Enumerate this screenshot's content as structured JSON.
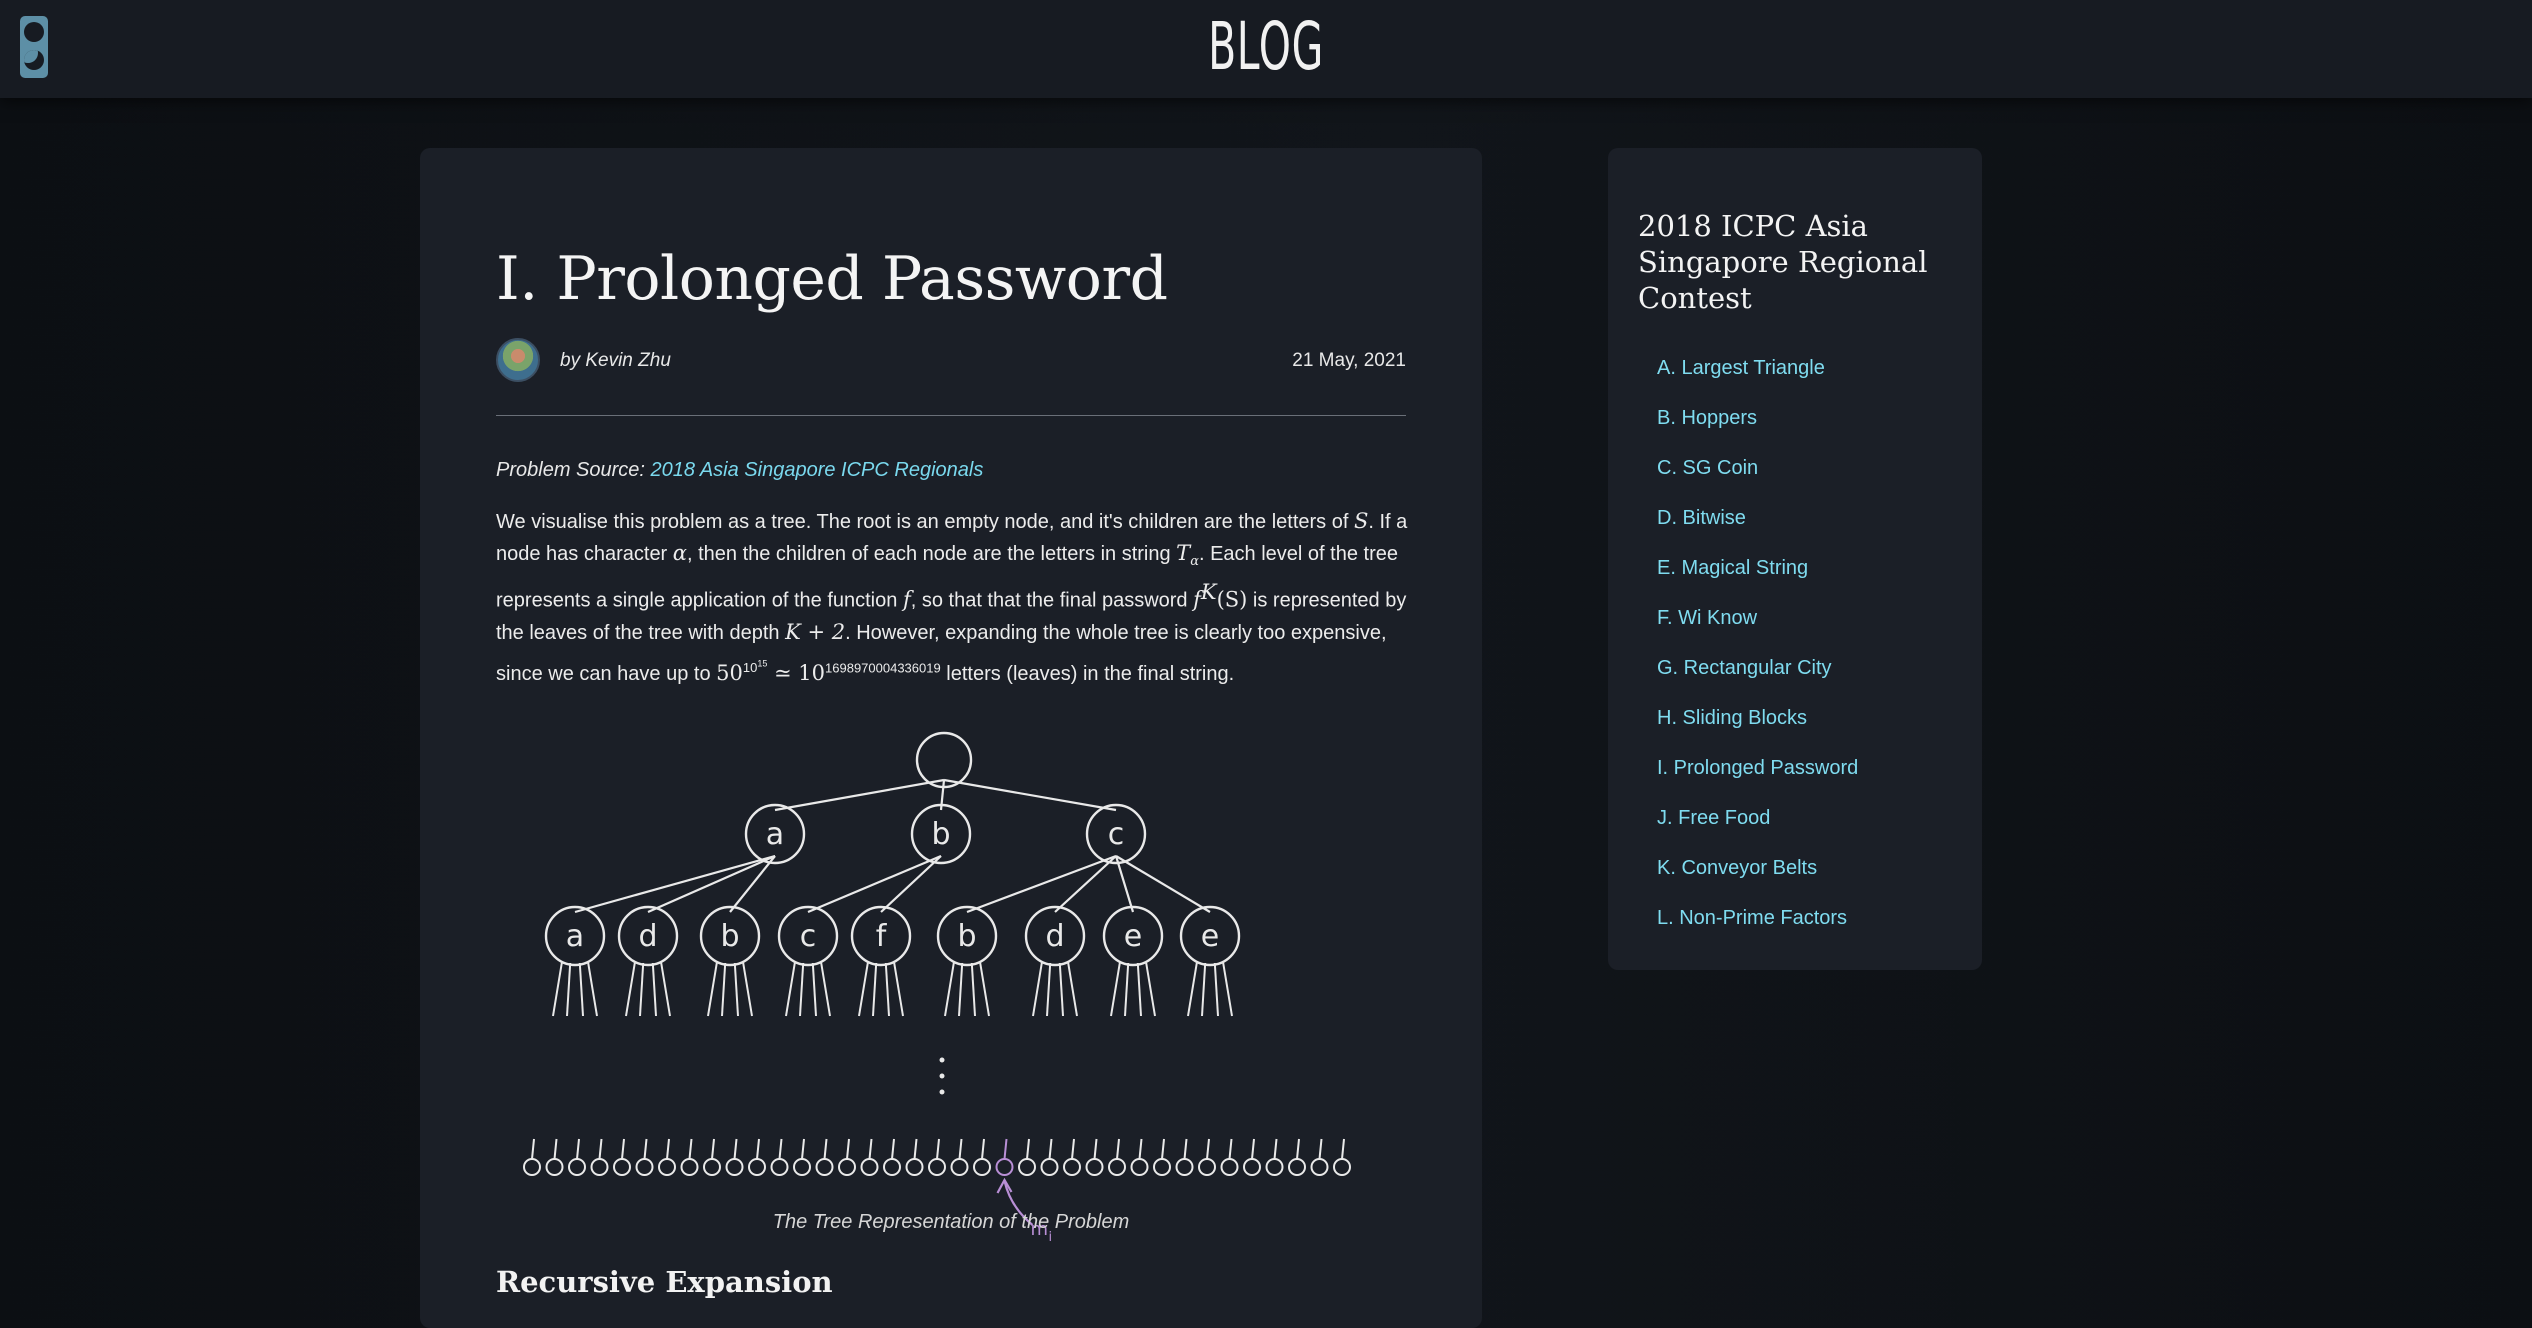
{
  "header": {
    "logo": "BLOG",
    "theme_toggle": "theme-toggle"
  },
  "article": {
    "title": "I. Prolonged Password",
    "author": "by Kevin Zhu",
    "date": "21 May, 2021",
    "source_label": "Problem Source:",
    "source_link": "2018 Asia Singapore ICPC Regionals",
    "paragraph": {
      "t1": "We visualise this problem as a tree. The root is an empty node, and it's children are the letters of ",
      "m1": "S",
      "t2": ". If a node has character ",
      "m2": "α",
      "t3": ", then the children of each node are the letters in string ",
      "m3": "T",
      "m3sub": "α",
      "t4": ". Each level of the tree represents a single application of the function ",
      "m4": "f",
      "t5": ", so that that the final password ",
      "m5": "f",
      "m5sup": "K",
      "m5b": "(S)",
      "t6": " is represented by the leaves of the tree with depth ",
      "m6": "K + 2",
      "t7": ". However, expanding the whole tree is clearly too expensive, since we can have up to ",
      "m7": "50",
      "m7sup": "10",
      "m7supsup": "15",
      "m8": " ≃ 10",
      "m8sup": "1698970004336019",
      "t8": " letters (leaves) in the final string."
    },
    "figure": {
      "level1": [
        "a",
        "b",
        "c"
      ],
      "level2": [
        "a",
        "d",
        "b",
        "c",
        "f",
        "b",
        "d",
        "e",
        "e"
      ],
      "marker": "m",
      "marker_sub": "i",
      "marker_color": "#b98fd6"
    },
    "caption": "The Tree Representation of the Problem",
    "section_title": "Recursive Expansion"
  },
  "sidebar": {
    "title": "2018 ICPC Asia Singapore Regional Contest",
    "items": [
      "A. Largest Triangle",
      "B. Hoppers",
      "C. SG Coin",
      "D. Bitwise",
      "E. Magical String",
      "F. Wi Know",
      "G. Rectangular City",
      "H. Sliding Blocks",
      "I. Prolonged Password",
      "J. Free Food",
      "K. Conveyor Belts",
      "L. Non-Prime Factors"
    ]
  },
  "colors": {
    "accent_link": "#7fdcf0",
    "card_bg": "#1b1f27",
    "page_bg": "#0f1216"
  }
}
